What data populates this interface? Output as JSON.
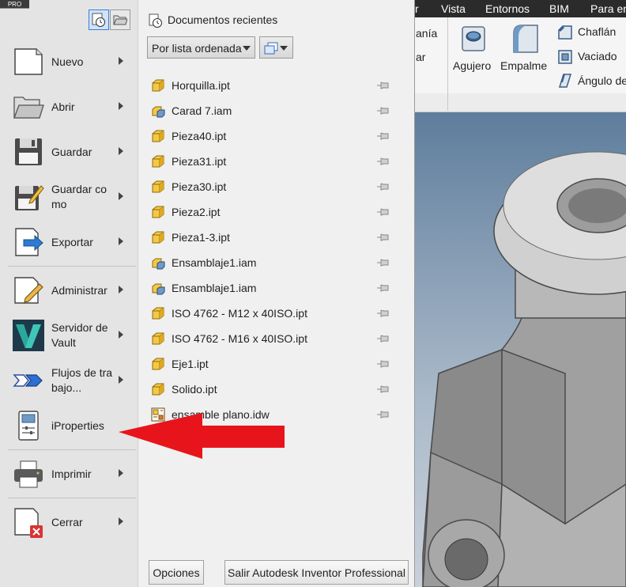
{
  "app": {
    "edition_tab": "PRO"
  },
  "ribbon": {
    "tabs": [
      "r",
      "Vista",
      "Entornos",
      "BIM",
      "Para en"
    ],
    "partial_labels": [
      "anía",
      "ar"
    ],
    "tools": {
      "agujero": "Agujero",
      "empalme": "Empalme",
      "chaflan": "Chaflán",
      "vaciado": "Vaciado",
      "angulo": "Ángulo de"
    }
  },
  "menu": {
    "items": [
      {
        "label": "Nuevo",
        "icon": "new-document-icon",
        "has_arrow": true
      },
      {
        "label": "Abrir",
        "icon": "open-folder-icon",
        "has_arrow": true
      },
      {
        "label": "Guardar",
        "icon": "floppy-disk-icon",
        "has_arrow": true
      },
      {
        "label": "Guardar como",
        "icon": "save-as-icon",
        "has_arrow": true
      },
      {
        "label": "Exportar",
        "icon": "export-icon",
        "has_arrow": true
      },
      {
        "label": "Administrar",
        "icon": "manage-icon",
        "has_arrow": true
      },
      {
        "label": "Servidor de Vault",
        "icon": "vault-icon",
        "has_arrow": true
      },
      {
        "label": "Flujos de trabajo...",
        "icon": "workflow-icon",
        "has_arrow": true
      },
      {
        "label": "iProperties",
        "icon": "iproperties-icon",
        "has_arrow": false
      },
      {
        "label": "Imprimir",
        "icon": "printer-icon",
        "has_arrow": true
      },
      {
        "label": "Cerrar",
        "icon": "close-document-icon",
        "has_arrow": true
      }
    ]
  },
  "recent": {
    "title": "Documentos recientes",
    "sort_value": "Por lista ordenada",
    "documents": [
      {
        "name": "Horquilla.ipt",
        "type": "part"
      },
      {
        "name": "Carad 7.iam",
        "type": "assembly"
      },
      {
        "name": "Pieza40.ipt",
        "type": "part"
      },
      {
        "name": "Pieza31.ipt",
        "type": "part"
      },
      {
        "name": "Pieza30.ipt",
        "type": "part"
      },
      {
        "name": "Pieza2.ipt",
        "type": "part"
      },
      {
        "name": "Pieza1-3.ipt",
        "type": "part"
      },
      {
        "name": "Ensamblaje1.iam",
        "type": "assembly"
      },
      {
        "name": "Ensamblaje1.iam",
        "type": "assembly"
      },
      {
        "name": "ISO 4762 - M12 x 40ISO.ipt",
        "type": "part"
      },
      {
        "name": "ISO 4762 - M16 x 40ISO.ipt",
        "type": "part"
      },
      {
        "name": "Eje1.ipt",
        "type": "part"
      },
      {
        "name": "Solido.ipt",
        "type": "part"
      },
      {
        "name": "ensamble plano.idw",
        "type": "drawing"
      }
    ]
  },
  "buttons": {
    "options": "Opciones",
    "exit": "Salir Autodesk Inventor Professional"
  },
  "colors": {
    "annotation_arrow": "#e8141c",
    "part_icon": "#f5c842",
    "accent": "#3d7fd6"
  }
}
